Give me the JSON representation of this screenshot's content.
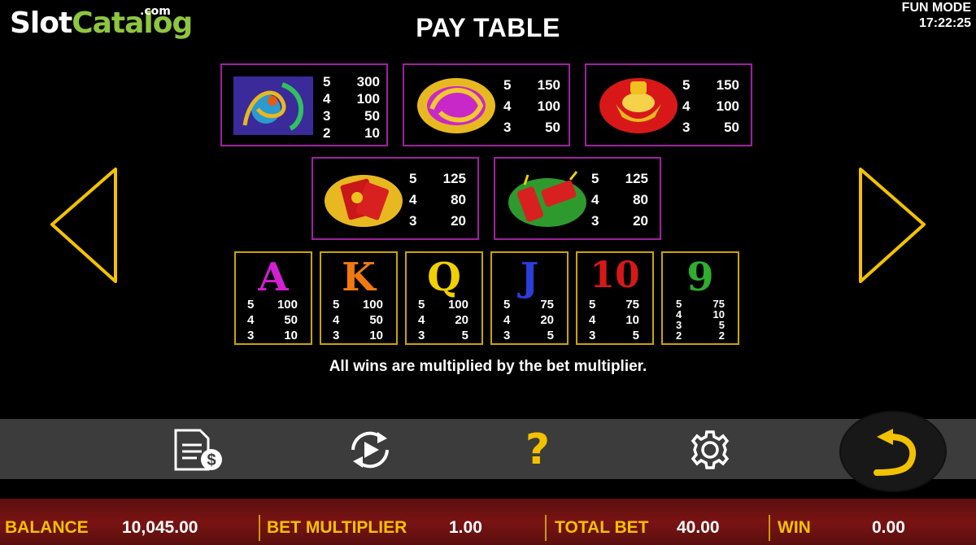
{
  "logo": {
    "slot": "Slot",
    "catalog": "Catalog",
    "com": ".com"
  },
  "mode": {
    "label": "FUN MODE",
    "time": "17:22:25"
  },
  "title": "PAY TABLE",
  "high_symbols": [
    {
      "name": "dragon-phoenix",
      "pays": [
        [
          "5",
          "300"
        ],
        [
          "4",
          "100"
        ],
        [
          "3",
          "50"
        ],
        [
          "2",
          "10"
        ]
      ]
    },
    {
      "name": "golden-dragon",
      "pays": [
        [
          "5",
          "150"
        ],
        [
          "4",
          "100"
        ],
        [
          "3",
          "50"
        ]
      ]
    },
    {
      "name": "gold-ingot",
      "pays": [
        [
          "5",
          "150"
        ],
        [
          "4",
          "100"
        ],
        [
          "3",
          "50"
        ]
      ]
    },
    {
      "name": "red-envelope",
      "pays": [
        [
          "5",
          "125"
        ],
        [
          "4",
          "80"
        ],
        [
          "3",
          "20"
        ]
      ]
    },
    {
      "name": "firecrackers",
      "pays": [
        [
          "5",
          "125"
        ],
        [
          "4",
          "80"
        ],
        [
          "3",
          "20"
        ]
      ]
    }
  ],
  "card_symbols": [
    {
      "letter": "A",
      "color": "#d21fd2",
      "pays": [
        [
          "5",
          "100"
        ],
        [
          "4",
          "50"
        ],
        [
          "3",
          "10"
        ]
      ]
    },
    {
      "letter": "K",
      "color": "#f07a10",
      "pays": [
        [
          "5",
          "100"
        ],
        [
          "4",
          "50"
        ],
        [
          "3",
          "10"
        ]
      ]
    },
    {
      "letter": "Q",
      "color": "#f0d000",
      "pays": [
        [
          "5",
          "100"
        ],
        [
          "4",
          "20"
        ],
        [
          "3",
          "5"
        ]
      ]
    },
    {
      "letter": "J",
      "color": "#2a3ed8",
      "pays": [
        [
          "5",
          "75"
        ],
        [
          "4",
          "20"
        ],
        [
          "3",
          "5"
        ]
      ]
    },
    {
      "letter": "10",
      "color": "#d81818",
      "pays": [
        [
          "5",
          "75"
        ],
        [
          "4",
          "10"
        ],
        [
          "3",
          "5"
        ]
      ]
    },
    {
      "letter": "9",
      "color": "#2fae2f",
      "pays": [
        [
          "5",
          "75"
        ],
        [
          "4",
          "10"
        ],
        [
          "3",
          "5"
        ],
        [
          "2",
          "2"
        ]
      ]
    }
  ],
  "note": "All wins are multiplied by the bet multiplier.",
  "toolbar": {
    "icons": [
      "paytable-icon",
      "autoplay-icon",
      "help-icon",
      "settings-icon",
      "back-icon"
    ],
    "help_glyph": "?"
  },
  "status": {
    "balance_label": "BALANCE",
    "balance_value": "10,045.00",
    "bet_label": "BET MULTIPLIER",
    "bet_value": "1.00",
    "total_label": "TOTAL BET",
    "total_value": "40.00",
    "win_label": "WIN",
    "win_value": "0.00"
  },
  "colors": {
    "accent": "#f2c200",
    "box_border": "#a020a0",
    "card_border": "#c9a400",
    "status_bg": "#6a1212"
  }
}
